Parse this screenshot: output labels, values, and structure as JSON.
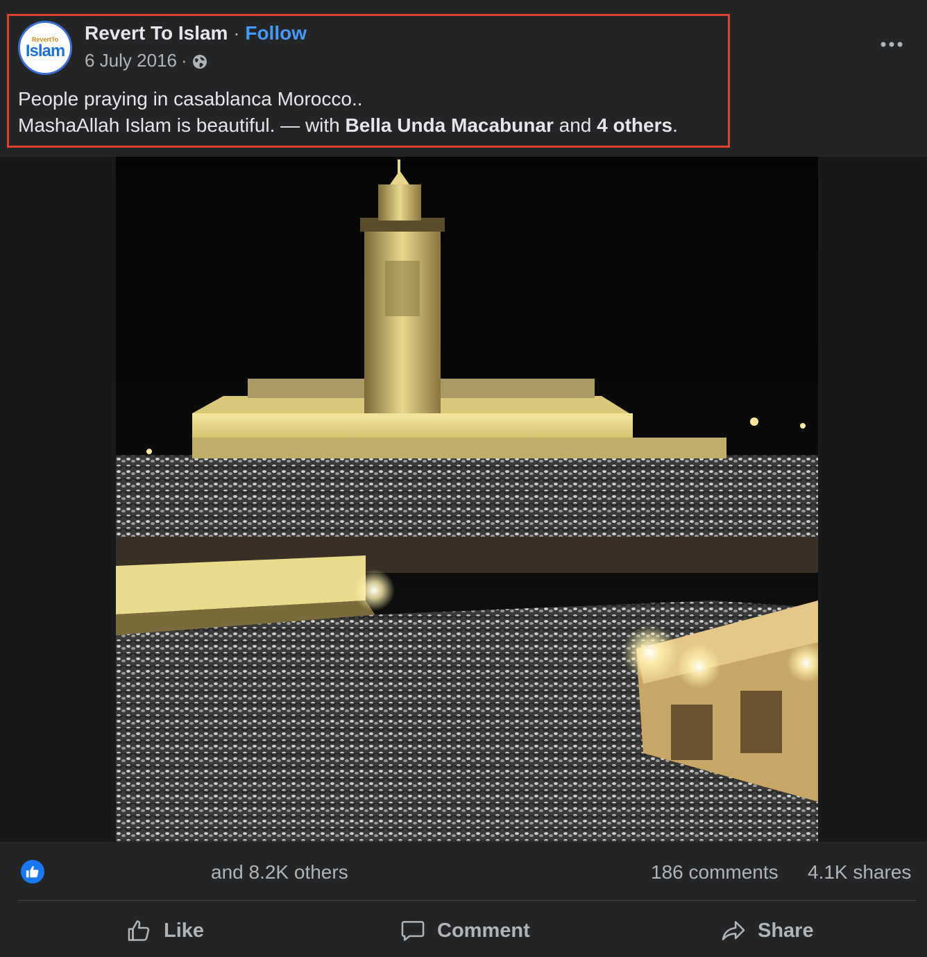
{
  "post": {
    "author": "Revert To Islam",
    "separator": "·",
    "follow_label": "Follow",
    "date": "6 July 2016",
    "meta_separator": "·",
    "privacy_icon": "globe-icon",
    "avatar_small_text": "RevertTo",
    "avatar_big_text": "Islam",
    "caption_line1": "People praying in casablanca Morocco..",
    "caption_line2_prefix": "MashaAllah Islam is beautiful. — with ",
    "tagged_name": "Bella Unda Macabunar",
    "caption_and": " and ",
    "tagged_others": "4 others",
    "caption_end": ".",
    "more_icon": "more-options-icon"
  },
  "stats": {
    "reaction_icon": "like-reaction-icon",
    "reactions_text": "and 8.2K others",
    "comments": "186 comments",
    "shares": "4.1K shares"
  },
  "actions": {
    "like": "Like",
    "comment": "Comment",
    "share": "Share"
  },
  "colors": {
    "background": "#242526",
    "follow": "#4599ff",
    "highlight": "#e0402f",
    "like_blue": "#1877f2"
  }
}
